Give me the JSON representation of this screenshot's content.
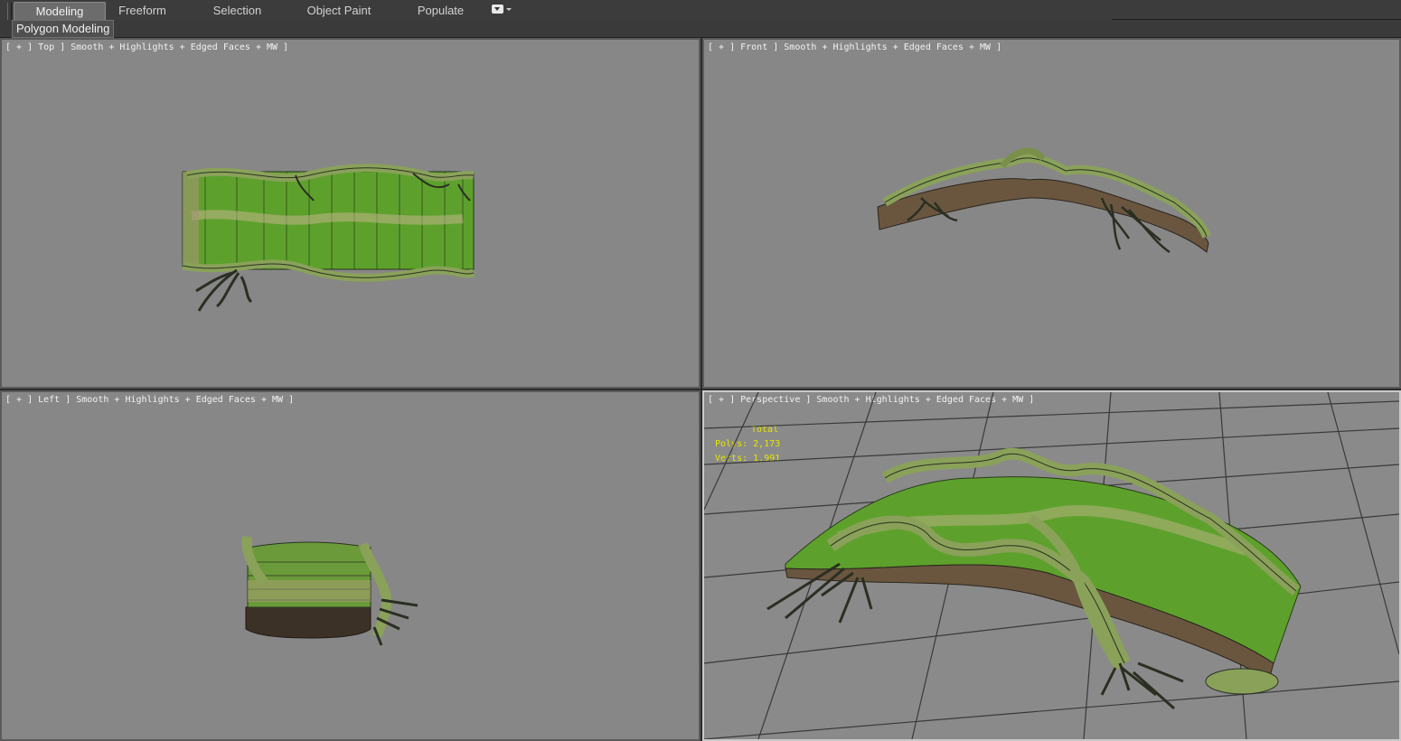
{
  "ribbon": {
    "tabs": [
      {
        "label": "Modeling",
        "active": true
      },
      {
        "label": "Freeform",
        "active": false
      },
      {
        "label": "Selection",
        "active": false
      },
      {
        "label": "Object Paint",
        "active": false
      },
      {
        "label": "Populate",
        "active": false
      }
    ],
    "dropdown_icon": "ribbon-options-icon"
  },
  "subbar": {
    "panel_label": "Polygon Modeling"
  },
  "viewports": {
    "top": {
      "label": "[ + ] Top ] Smooth + Highlights + Edged Faces + MW ]"
    },
    "front": {
      "label": "[ + ] Front ] Smooth + Highlights + Edged Faces + MW ]"
    },
    "left": {
      "label": "[ + ] Left ] Smooth + Highlights + Edged Faces + MW ]"
    },
    "perspective": {
      "label": "[ + ] Perspective ] Smooth + Highlights + Edged Faces + MW ]"
    }
  },
  "stats": {
    "title": "Total",
    "polys_label": "Polys:",
    "polys_value": "2,173",
    "verts_label": "Verts:",
    "verts_value": "1,991"
  },
  "colors": {
    "viewport_bg": "#878787",
    "active_border": "#c9c9c9",
    "stats_text": "#e6e600",
    "grass": "#5da12c",
    "root": "#7d8c4d",
    "wood": "#5a4a38"
  }
}
